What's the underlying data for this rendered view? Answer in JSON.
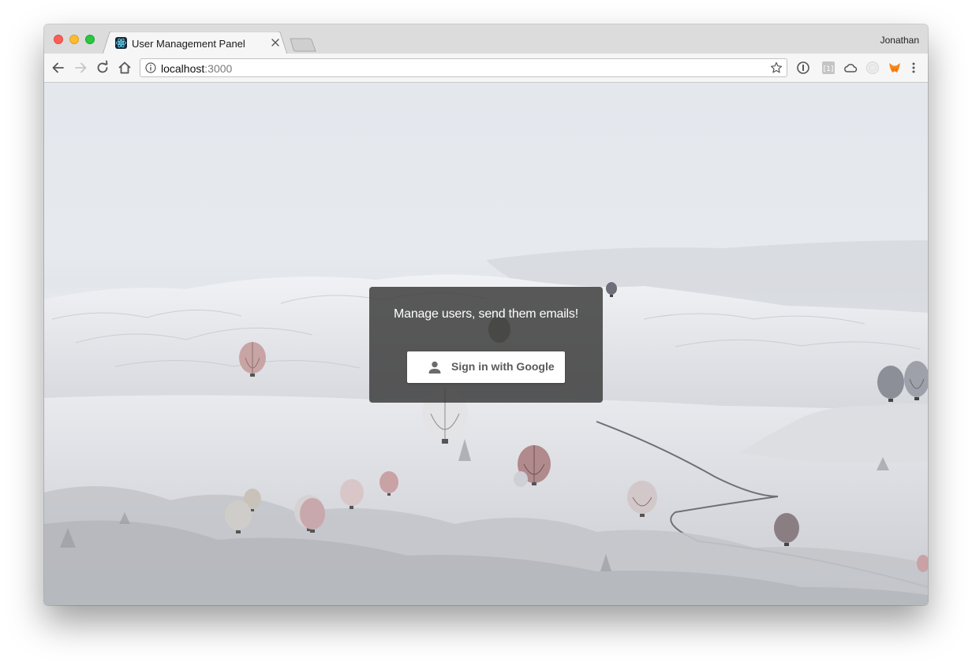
{
  "browser": {
    "profile_name": "Jonathan",
    "tab": {
      "title": "User Management Panel",
      "favicon": "react-icon"
    },
    "address": {
      "host": "localhost",
      "port": ":3000"
    },
    "toolbar_icons": [
      "back-icon",
      "forward-icon",
      "reload-icon",
      "home-icon",
      "info-icon",
      "star-icon",
      "onepassword-icon",
      "extension-icon",
      "cloud-icon",
      "extension-circle-icon",
      "metamask-fox-icon",
      "menu-icon"
    ]
  },
  "page": {
    "tagline": "Manage users, send them emails!",
    "signin_label": "Sign in with Google",
    "signin_icon": "person-icon",
    "background": "hot-air-balloons-snowy-landscape"
  },
  "colors": {
    "overlay": "#373737",
    "button": "#ffffff",
    "button_text": "#5a5a5a",
    "traffic_close": "#fc5f57",
    "traffic_minimize": "#fdbc2e",
    "traffic_maximize": "#28c840"
  }
}
